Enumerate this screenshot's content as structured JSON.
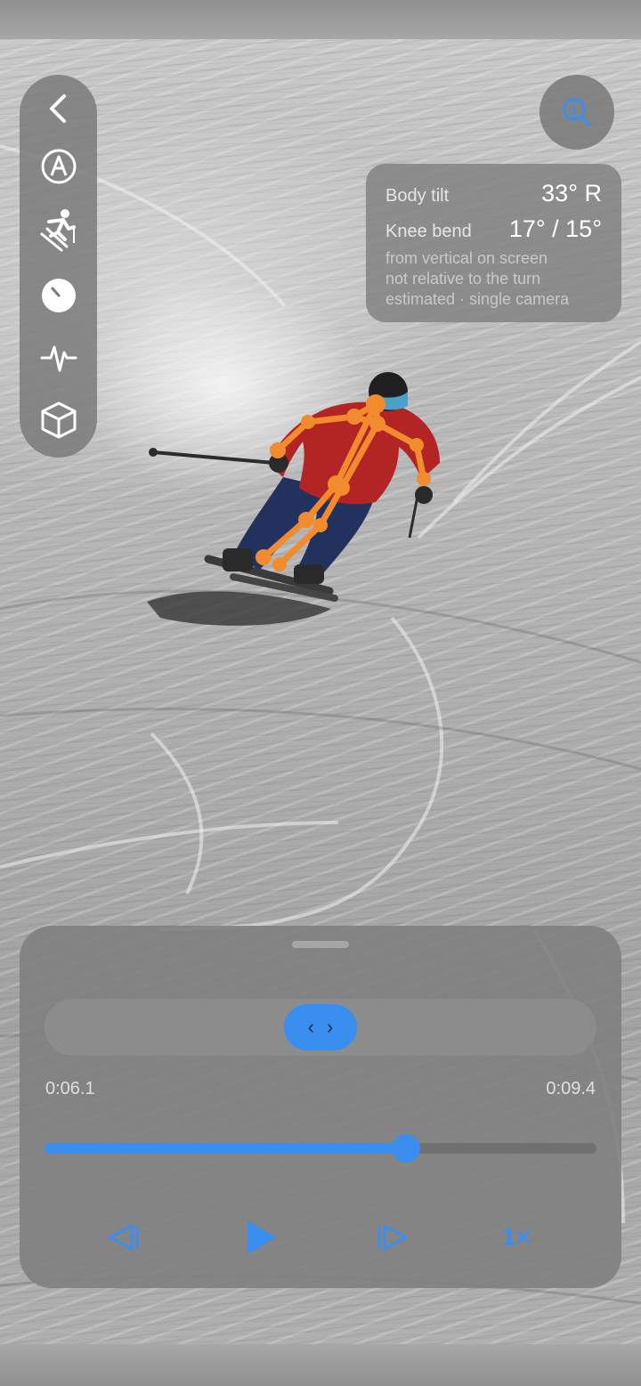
{
  "toolbar": {
    "items": [
      {
        "icon": "back-chevron-icon"
      },
      {
        "icon": "compass-pen-icon"
      },
      {
        "icon": "skier-icon"
      },
      {
        "icon": "gauge-icon"
      },
      {
        "icon": "waveform-icon"
      },
      {
        "icon": "cube-icon"
      }
    ]
  },
  "zoom": {
    "icon": "zoom-magnifier-icon"
  },
  "metrics": {
    "body_tilt_label": "Body tilt",
    "body_tilt_value": "33° R",
    "knee_bend_label": "Knee bend",
    "knee_bend_value": "17° / 15°",
    "note_line1": "from vertical on screen",
    "note_line2": "not relative to the turn",
    "note_line3": "estimated · single camera"
  },
  "player": {
    "trim_left_glyph": "‹",
    "trim_right_glyph": "›",
    "start_time": "0:06.1",
    "end_time": "0:09.4",
    "progress_fraction": 0.655,
    "speed_label": "1×"
  },
  "colors": {
    "accent": "#3a8ef0",
    "skeleton": "#f28a2e",
    "jacket": "#b32424",
    "pants": "#23315f"
  }
}
